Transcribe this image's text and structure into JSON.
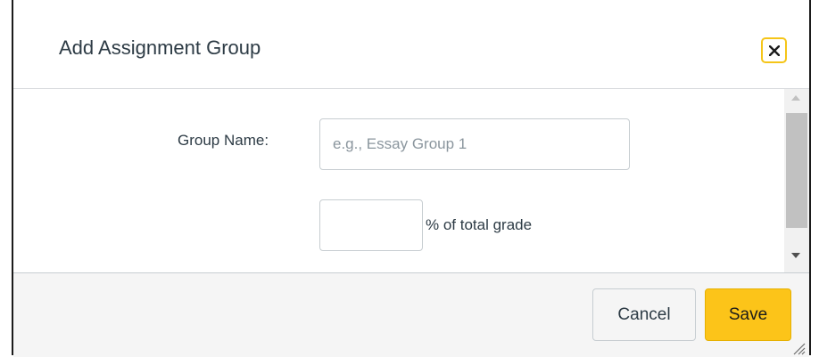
{
  "dialog": {
    "title": "Add Assignment Group",
    "close_icon": "close-icon"
  },
  "form": {
    "group_name_label": "Group Name:",
    "group_name_value": "",
    "group_name_placeholder": "e.g., Essay Group 1",
    "percent_value": "",
    "percent_label": "% of total grade"
  },
  "footer": {
    "cancel_label": "Cancel",
    "save_label": "Save"
  },
  "colors": {
    "accent": "#fcc419",
    "focus_ring": "#f5c518",
    "text": "#2d3b45"
  }
}
